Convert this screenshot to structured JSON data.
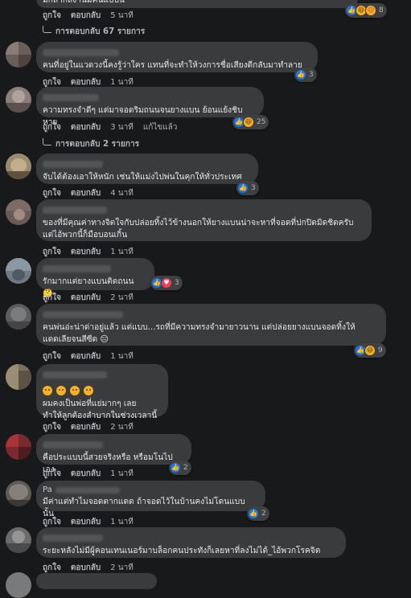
{
  "top_partial": {
    "text": "มีกลากลงานมีคนแบบนี้",
    "reactions": {
      "count": "8"
    }
  },
  "comments": [
    {
      "text": "",
      "actions": {
        "like": "ถูกใจ",
        "reply": "ตอบกลับ",
        "time": "5 นาที"
      },
      "replies_link": "การตอบกลับ 67 รายการ"
    },
    {
      "text": "คนที่อยู่ในแวดวงนี้คงรู้ว่าใคร แทนที่จะทำให้วงการชื่อเสียงดีกลับมาทำลาย",
      "actions": {
        "like": "ถูกใจ",
        "reply": "ตอบกลับ",
        "time": "1 นาที"
      },
      "reactions": {
        "count": "3"
      }
    },
    {
      "text": "ความทรงจำดีๆ แต่มาจอดริมถนนจนยางแบน ย้อนแย้งชิบหาย",
      "actions": {
        "like": "ถูกใจ",
        "reply": "ตอบกลับ",
        "time": "3 นาที",
        "edited": "แก้ไขแล้ว"
      },
      "reactions": {
        "count": "25"
      },
      "replies_link": "การตอบกลับ 2 รายการ"
    },
    {
      "text": "จับได้ต้องเอาให้หนัก เช่นให้แม่งไปพ่นในคุกให้ทั่วประเทศ",
      "actions": {
        "like": "ถูกใจ",
        "reply": "ตอบกลับ",
        "time": "4 นาที"
      },
      "reactions": {
        "count": "3"
      }
    },
    {
      "text": "ของที่มีคุณค่าทางจิตใจกับปล่อยทิ้งไว้ข้างนอกให้ยางแบนน่าจะหาที่จอดที่ปกปิดมิดชิดครับ\nแต่ไอ้พวกนี้ก็มือบอนเกิ้น",
      "actions": {
        "like": "ถูกใจ",
        "reply": "ตอบกลับ",
        "time": "1 นาที"
      }
    },
    {
      "text": "รักมากแต่ยางแบนติดถนน 🤔",
      "actions": {
        "like": "ถูกใจ",
        "reply": "ตอบกลับ",
        "time": "2 นาที"
      },
      "reactions": {
        "count": "3"
      }
    },
    {
      "text": "คนพ่นอ่ะน่าด่าอยู่แล้ว แต่แบบ...รถที่มีความทรงจำมายาวนาน แต่ปล่อยยางแบนจอดทิ้งให้\nแดดเลียจนสีซีด 😑",
      "actions": {
        "like": "ถูกใจ",
        "reply": "ตอบกลับ",
        "time": "1 นาที"
      },
      "reactions": {
        "count": "9"
      }
    },
    {
      "text": "ผมคงเป็นพ่อที่แย่มากๆ เลย\nทำให้ลูกต้องลำบากในช่วงเวลานี้",
      "actions": {
        "like": "ถูกใจ",
        "reply": "ตอบกลับ",
        "time": "2 นาที"
      }
    },
    {
      "text": "คือประแบบนี้สวยจริงหรือ หรือมโนไปเอง",
      "actions": {
        "like": "ถูกใจ",
        "reply": "ตอบกลับ",
        "time": "1 นาที"
      },
      "reactions": {
        "count": "2"
      }
    },
    {
      "name_prefix": "Pa",
      "text": "มีค่าแต่ทำไมจอดตากแดด ถ้าจอดไว้ในบ้านคงไม่โดนแบบนั้น",
      "actions": {
        "like": "ถูกใจ",
        "reply": "ตอบกลับ",
        "time": "1 นาที"
      },
      "reactions": {
        "count": "2"
      }
    },
    {
      "text": "ระยะหลังไม่มีผู้คอนเทนเนอร์มาบล็อกคนประทังก็เลยหาที่ลงไม่ได้_ไอ้พวกโรคจิต",
      "actions": {
        "like": "ถูกใจ",
        "reply": "ตอบกลับ",
        "time": "2 นาที"
      }
    },
    {
      "text": "",
      "actions": {
        "like": "ถูกใจ",
        "reply": "ตอบกลับ",
        "time": "2 นาที"
      }
    }
  ],
  "colors": {
    "background": "#18191a",
    "bubble": "#3a3b3c",
    "like_blue": "#1877f2",
    "haha_yellow": "#f7b125",
    "love_red": "#f33e58"
  }
}
